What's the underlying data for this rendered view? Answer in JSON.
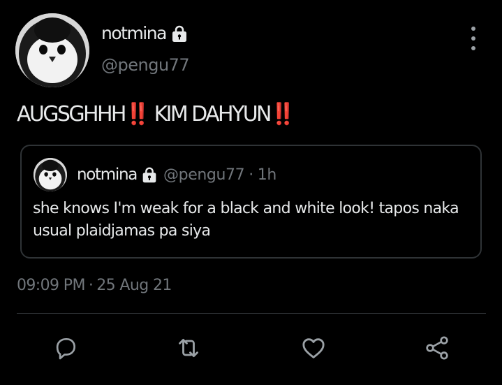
{
  "tweet": {
    "author": {
      "display_name": "notmina",
      "handle": "@pengu77",
      "protected_icon": "lock-icon",
      "avatar": "penguin-avatar"
    },
    "text": "AUGSGHHH‼️ KIM DAHYUN‼️",
    "menu_icon": "more-vertical-icon",
    "quoted": {
      "display_name": "notmina",
      "handle": "@pengu77",
      "separator": "·",
      "time": "1h",
      "text": "she knows I'm weak for a black and white look! tapos naka usual plaidjamas pa siya"
    },
    "timestamp": {
      "time": "09:09 PM",
      "separator": "·",
      "date": "25 Aug 21"
    },
    "actions": [
      {
        "name": "reply",
        "icon": "reply-icon"
      },
      {
        "name": "retweet",
        "icon": "retweet-icon"
      },
      {
        "name": "like",
        "icon": "heart-icon"
      },
      {
        "name": "share",
        "icon": "share-icon"
      }
    ]
  },
  "colors": {
    "background": "#000000",
    "primary_text": "#e7e9ea",
    "secondary_text": "#71767b",
    "border": "#2f3336",
    "icon": "#9ba1a6"
  }
}
